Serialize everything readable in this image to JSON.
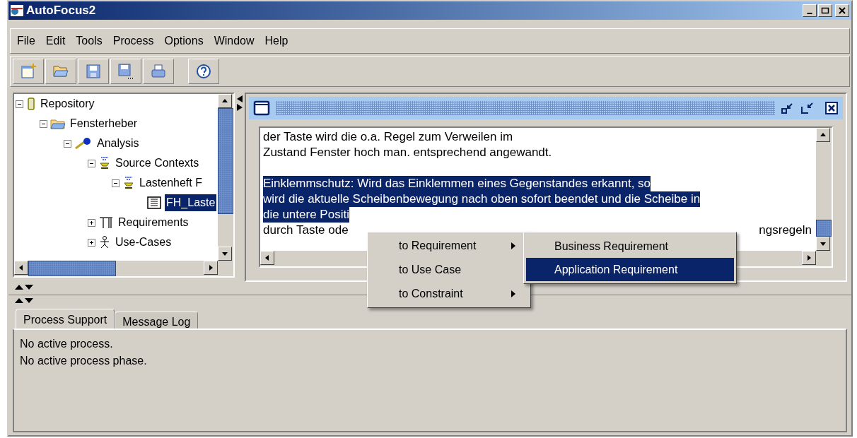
{
  "window": {
    "title": "AutoFocus2"
  },
  "menu": [
    "File",
    "Edit",
    "Tools",
    "Process",
    "Options",
    "Window",
    "Help"
  ],
  "tree": [
    {
      "label": "Repository",
      "kind": "repository",
      "expanded": true,
      "selected": false,
      "children": [
        {
          "label": "Fensterheber",
          "kind": "folder",
          "expanded": true,
          "selected": false,
          "children": [
            {
              "label": "Analysis",
              "kind": "key",
              "expanded": true,
              "selected": false,
              "children": [
                {
                  "label": "Source Contexts",
                  "kind": "source",
                  "expanded": true,
                  "selected": false,
                  "children": [
                    {
                      "label": "Lastenheft F",
                      "kind": "source",
                      "expanded": true,
                      "selected": false,
                      "children": [
                        {
                          "label": "FH_Laste",
                          "kind": "document",
                          "selected": true
                        }
                      ]
                    }
                  ]
                },
                {
                  "label": "Requirements",
                  "kind": "requirements",
                  "expanded": false,
                  "selected": false
                },
                {
                  "label": "Use-Cases",
                  "kind": "actor",
                  "expanded": false,
                  "selected": false
                }
              ]
            }
          ]
        }
      ]
    }
  ],
  "editor": {
    "paragraphs": [
      [
        {
          "selected": false,
          "text": "der Taste wird die o.a. Regel zum Verweilen im"
        },
        {
          "selected": false,
          "text": "Zustand Fenster hoch man. entsprechend angewandt."
        }
      ],
      [
        {
          "selected": true,
          "text": "Einklemmschutz: Wird das Einklemmen eines Gegenstandes erkannt, so"
        },
        {
          "selected": true,
          "text": "wird die aktuelle Scheibenbewegung nach oben sofort beendet und die Scheibe in"
        },
        {
          "selected": true,
          "text": "die untere Positi"
        },
        {
          "selected": false,
          "text": "durch Taste ode",
          "tail": "ngsregeln"
        }
      ]
    ]
  },
  "context_menu": [
    {
      "label": "to Requirement",
      "submenu": true,
      "selected": false
    },
    {
      "label": "to Use Case",
      "submenu": false,
      "selected": false
    },
    {
      "label": "to Constraint",
      "submenu": true,
      "selected": false
    }
  ],
  "submenu": [
    {
      "label": "Business Requirement",
      "selected": false
    },
    {
      "label": "Application Requirement",
      "selected": true
    }
  ],
  "bottom_tabs": [
    {
      "label": "Process Support",
      "selected": true
    },
    {
      "label": "Message Log",
      "selected": false
    }
  ],
  "process_messages": [
    "No active process.",
    "No active process phase."
  ]
}
